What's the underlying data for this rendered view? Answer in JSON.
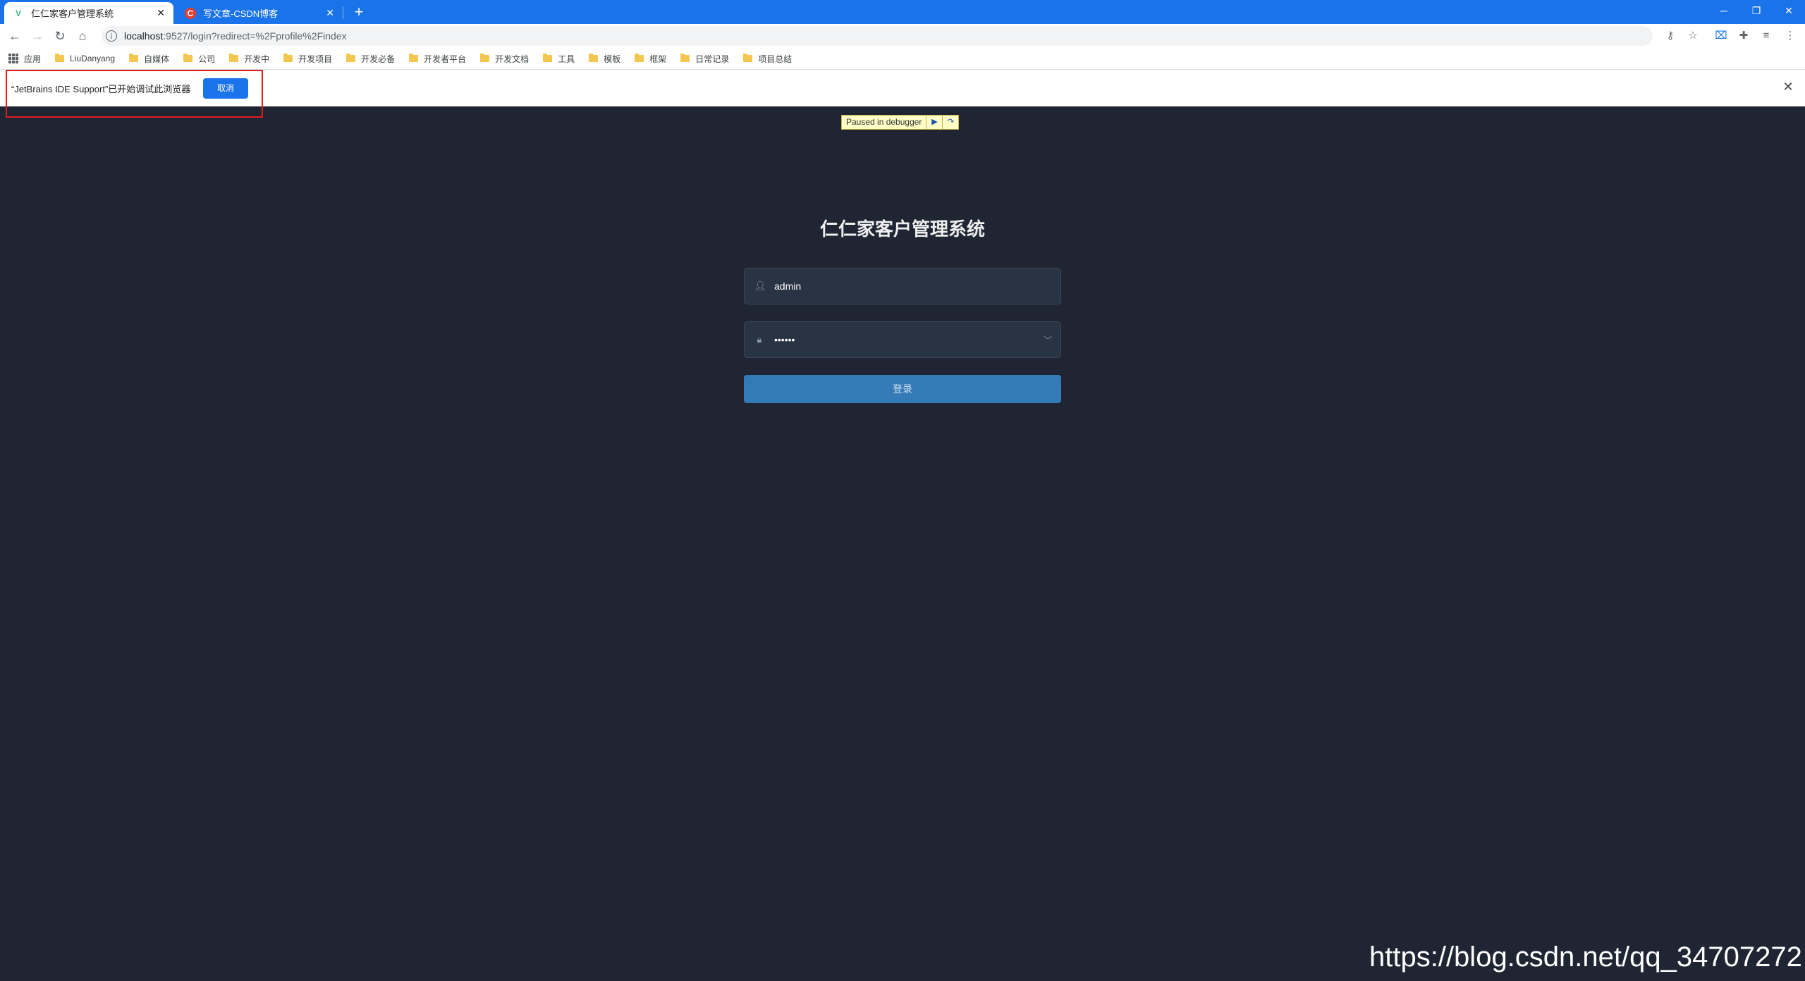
{
  "browser": {
    "tabs": [
      {
        "title": "仁仁家客户管理系统",
        "favicon": "vue-logo-icon",
        "active": true
      },
      {
        "title": "写文章-CSDN博客",
        "favicon": "csdn-logo-icon",
        "active": false
      }
    ],
    "address": {
      "host": "localhost",
      "path": ":9527/login?redirect=%2Fprofile%2Findex"
    },
    "bookmarks": {
      "apps_label": "应用",
      "folders": [
        "LiuDanyang",
        "自媒体",
        "公司",
        "开发中",
        "开发项目",
        "开发必备",
        "开发者平台",
        "开发文档",
        "工具",
        "模板",
        "框架",
        "日常记录",
        "项目总结"
      ]
    }
  },
  "infobar": {
    "message": "“JetBrains IDE Support”已开始调试此浏览器",
    "cancel_label": "取消"
  },
  "debugger": {
    "label": "Paused in debugger"
  },
  "login": {
    "title": "仁仁家客户管理系统",
    "username": "admin",
    "password_mask": "••••••",
    "submit_label": "登录"
  },
  "watermark": {
    "text": "https://blog.csdn.net/qq_34707272"
  },
  "colors": {
    "tab_strip": "#1a73e8",
    "page_bg": "#1f2533",
    "input_bg": "#283443",
    "login_button": "#337ab7",
    "highlight_box": "#e21e1e"
  }
}
